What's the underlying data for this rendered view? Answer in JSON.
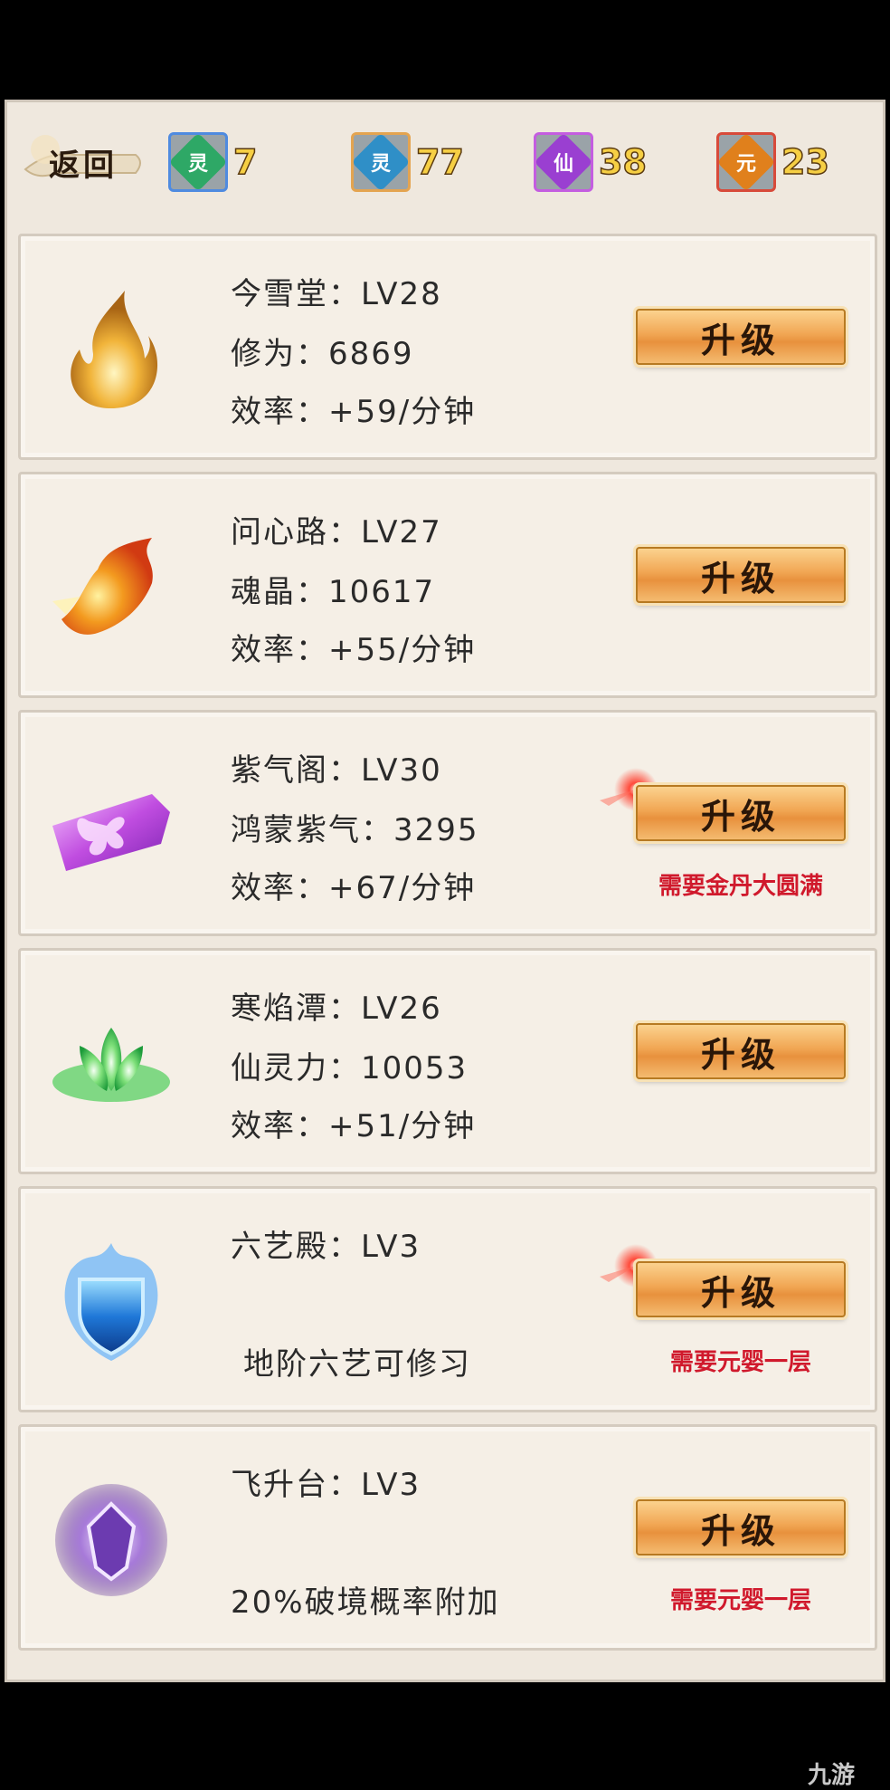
{
  "back_label": "返回",
  "currencies": [
    {
      "glyph": "灵",
      "value": "7",
      "color": "#2ea866",
      "border": "#4f8be0"
    },
    {
      "glyph": "灵",
      "value": "77",
      "color": "#2f8fc7",
      "border": "#e4a450"
    },
    {
      "glyph": "仙",
      "value": "38",
      "color": "#9a3fd1",
      "border": "#c45de0"
    },
    {
      "glyph": "元",
      "value": "23",
      "color": "#e0801c",
      "border": "#d84a3a"
    }
  ],
  "upgrade_label": "升级",
  "buildings": [
    {
      "title": "今雪堂：LV28",
      "stat": "修为：6869",
      "rate": "效率：+59/分钟",
      "requirement": "",
      "icon": "golden-flame-icon"
    },
    {
      "title": "问心路：LV27",
      "stat": "魂晶：10617",
      "rate": "效率：+55/分钟",
      "requirement": "",
      "icon": "fire-phoenix-icon"
    },
    {
      "title": "紫气阁：LV30",
      "stat": "鸿蒙紫气：3295",
      "rate": "效率：+67/分钟",
      "requirement": "需要金丹大圆满",
      "icon": "purple-butterfly-icon"
    },
    {
      "title": "寒焰潭：LV26",
      "stat": "仙灵力：10053",
      "rate": "效率：+51/分钟",
      "requirement": "",
      "icon": "green-lotus-icon"
    },
    {
      "title": "六艺殿：LV3",
      "stat": "",
      "rate": "地阶六艺可修习",
      "requirement": "需要元婴一层",
      "icon": "blue-shield-icon"
    },
    {
      "title": "飞升台：LV3",
      "stat": "",
      "rate": "20%破境概率附加",
      "requirement": "需要元婴一层",
      "icon": "violet-crystal-icon"
    }
  ],
  "watermark": "九游"
}
